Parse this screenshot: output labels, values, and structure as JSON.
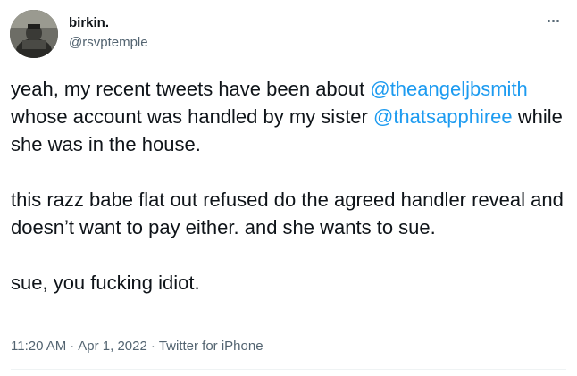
{
  "author": {
    "display_name": "birkin.",
    "handle": "@rsvptemple",
    "avatar_icon": "profile-photo"
  },
  "more_icon": "more-dots-icon",
  "tweet": {
    "p1": {
      "t1": "yeah, my recent tweets have been about ",
      "m1": "@theangeljbsmith",
      "t2": " whose account was handled by my sister ",
      "m2": "@thatsapphiree",
      "t3": " while she was in the house."
    },
    "p2": "this razz babe flat out refused do the agreed handler reveal and doesn’t want to pay either. and she wants to sue.",
    "p3": "sue, you fucking idiot."
  },
  "meta": {
    "time": "11:20 AM",
    "date": "Apr 1, 2022",
    "source": "Twitter for iPhone",
    "separator": "·"
  },
  "colors": {
    "text": "#0f1419",
    "secondary": "#536471",
    "link": "#1d9bf0",
    "divider": "#eff3f4"
  }
}
